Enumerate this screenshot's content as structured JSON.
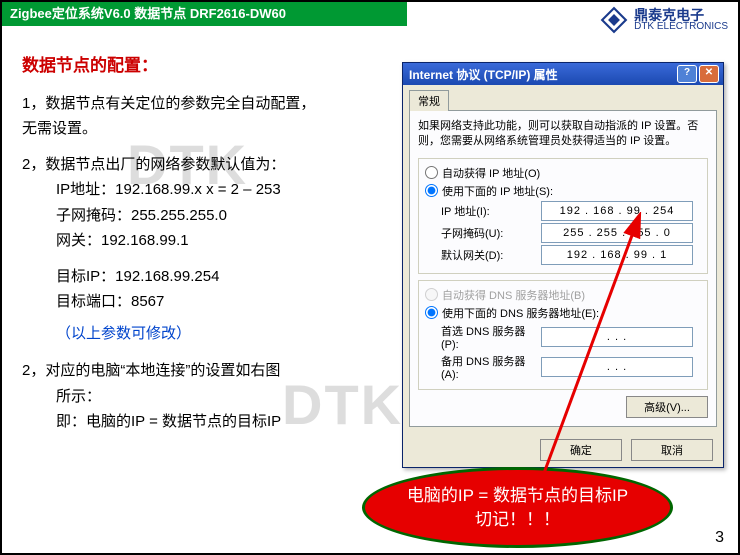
{
  "header": {
    "title": "Zigbee定位系统V6.0 数据节点 DRF2616-DW60"
  },
  "logo": {
    "cn": "鼎泰克电子",
    "en": "DTK ELECTRONICS"
  },
  "watermark": "DTK",
  "left": {
    "title": "数据节点的配置：",
    "p1a": "1，数据节点有关定位的参数完全自动配置，",
    "p1b": "无需设置。",
    "p2": "2，数据节点出厂的网络参数默认值为：",
    "ip_line": "IP地址：192.168.99.x   x = 2 – 253",
    "mask_line": "子网掩码：255.255.255.0",
    "gw_line": "网关：192.168.99.1",
    "tgt_ip": "目标IP：192.168.99.254",
    "tgt_port": "目标端口：8567",
    "note": "（以上参数可修改）",
    "p3a": "2，对应的电脑“本地连接”的设置如右图",
    "p3b": "所示：",
    "p3c": "即：电脑的IP = 数据节点的目标IP"
  },
  "win": {
    "title": "Internet 协议 (TCP/IP) 属性",
    "tab": "常规",
    "desc": "如果网络支持此功能，则可以获取自动指派的 IP 设置。否则，您需要从网络系统管理员处获得适当的 IP 设置。",
    "auto_ip": "自动获得 IP 地址(O)",
    "use_ip": "使用下面的 IP 地址(S):",
    "lbl_ip": "IP 地址(I):",
    "lbl_mask": "子网掩码(U):",
    "lbl_gw": "默认网关(D):",
    "val_ip": "192 . 168 .  99 . 254",
    "val_mask": "255 . 255 . 255 .   0",
    "val_gw": "192 . 168 .  99 .   1",
    "auto_dns": "自动获得 DNS 服务器地址(B)",
    "use_dns": "使用下面的 DNS 服务器地址(E):",
    "lbl_dns1": "首选 DNS 服务器(P):",
    "lbl_dns2": "备用 DNS 服务器(A):",
    "dns_blank": " .       .       . ",
    "adv": "高级(V)...",
    "ok": "确定",
    "cancel": "取消"
  },
  "callout": {
    "line1": "电脑的IP = 数据节点的目标IP",
    "line2": "切记！！！"
  },
  "page": "3"
}
